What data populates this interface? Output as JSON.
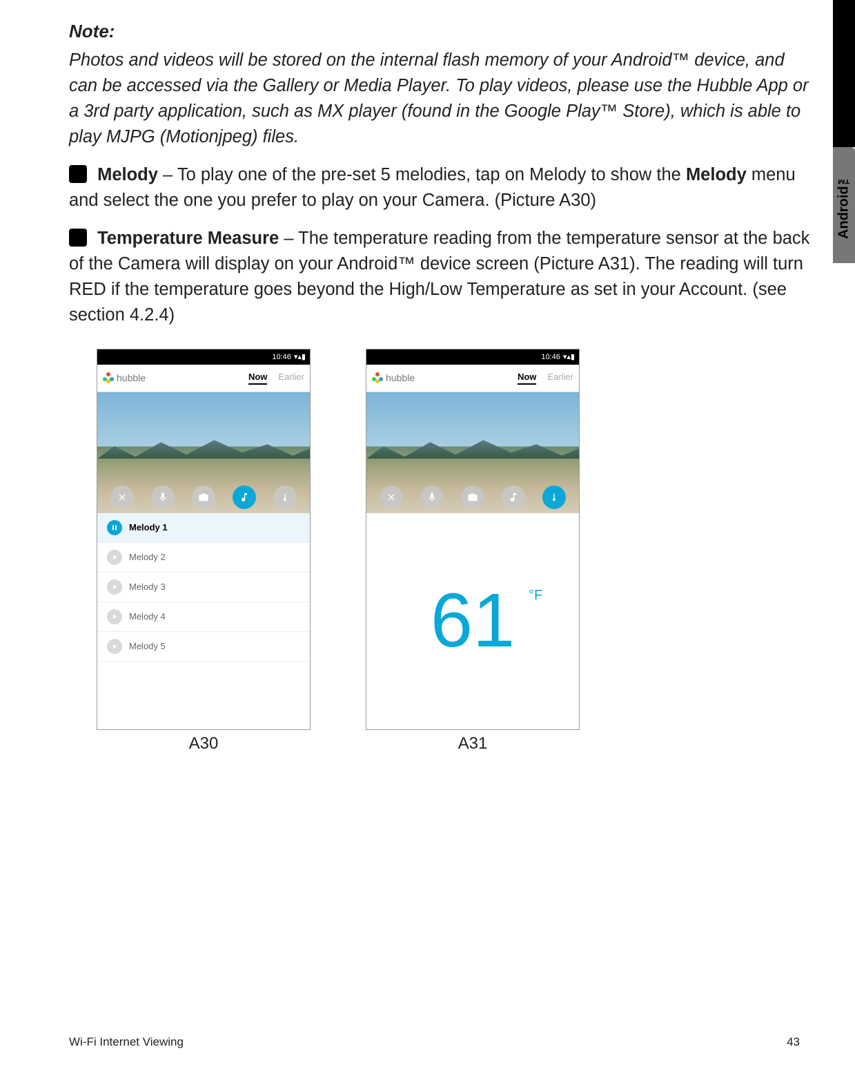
{
  "side_tab": "Android™",
  "note": {
    "heading": "Note:",
    "text": "Photos and videos will be stored on the internal flash memory of your Android™ device, and can be accessed via the Gallery or Media Player. To play videos, please use the Hubble App or a 3rd party application, such as MX player (found in the Google Play™ Store), which is able to play MJPG (Motionjpeg) files."
  },
  "melody_section": {
    "title": "Melody",
    "dash": " – ",
    "body_before": "To play one of the pre-set 5 melodies, tap on Melody to show the ",
    "bold_word": "Melody",
    "body_after": " menu and select the one you prefer to play on your Camera. (Picture A30)"
  },
  "temp_section": {
    "title": "Temperature Measure",
    "dash": " – ",
    "body": "The temperature reading from the temperature sensor at the back of the Camera will display on your Android™ device screen (Picture A31). The reading will turn RED if the temperature goes beyond the High/Low Temperature as set in your Account. (see section 4.2.4)"
  },
  "figures": {
    "a30_caption": "A30",
    "a31_caption": "A31"
  },
  "phone_common": {
    "status_time": "10:46",
    "app_name": "hubble",
    "tab_now": "Now",
    "tab_earlier": "Earlier"
  },
  "a30": {
    "melodies": [
      {
        "label": "Melody 1",
        "selected": true
      },
      {
        "label": "Melody 2",
        "selected": false
      },
      {
        "label": "Melody 3",
        "selected": false
      },
      {
        "label": "Melody 4",
        "selected": false
      },
      {
        "label": "Melody 5",
        "selected": false
      }
    ],
    "active_action": "melody"
  },
  "a31": {
    "temperature_value": "61",
    "temperature_unit": "°F",
    "active_action": "temperature"
  },
  "footer": {
    "left": "Wi-Fi Internet Viewing",
    "right": "43"
  }
}
